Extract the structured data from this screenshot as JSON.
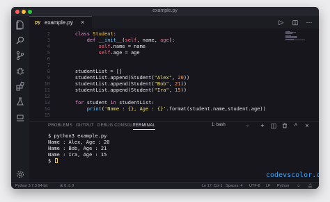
{
  "window": {
    "title": "example.py"
  },
  "tab": {
    "icon_text": "py",
    "label": "example.py",
    "close": "×"
  },
  "editor_actions": {
    "run": "▷",
    "split": "◫",
    "more": "···"
  },
  "code_lines": [
    {
      "n": "2",
      "tokens": [
        [
          "t",
          "    "
        ],
        [
          "kw",
          "class "
        ],
        [
          "cls",
          "Student"
        ],
        [
          "t",
          ":"
        ]
      ]
    },
    {
      "n": "3",
      "tokens": [
        [
          "t",
          "        "
        ],
        [
          "kw",
          "def "
        ],
        [
          "fn",
          "__init__"
        ],
        [
          "t",
          "("
        ],
        [
          "slf",
          "self"
        ],
        [
          "t",
          ", name, "
        ],
        [
          "slf",
          "age"
        ],
        [
          "t",
          "):"
        ]
      ]
    },
    {
      "n": "4",
      "tokens": [
        [
          "t",
          "            "
        ],
        [
          "slf",
          "self"
        ],
        [
          "t",
          ".name = name"
        ]
      ]
    },
    {
      "n": "5",
      "tokens": [
        [
          "t",
          "            "
        ],
        [
          "slf",
          "self"
        ],
        [
          "t",
          ".age = age"
        ]
      ]
    },
    {
      "n": "6",
      "tokens": []
    },
    {
      "n": "7",
      "tokens": []
    },
    {
      "n": "8",
      "tokens": [
        [
          "t",
          "    studentList = []"
        ]
      ]
    },
    {
      "n": "9",
      "tokens": [
        [
          "t",
          "    studentList.append(Student("
        ],
        [
          "str",
          "\"Alex\""
        ],
        [
          "t",
          ", "
        ],
        [
          "num",
          "20"
        ],
        [
          "t",
          "))"
        ]
      ]
    },
    {
      "n": "10",
      "tokens": [
        [
          "t",
          "    studentList.append(Student("
        ],
        [
          "str",
          "\"Bob\""
        ],
        [
          "t",
          ", "
        ],
        [
          "num",
          "21"
        ],
        [
          "t",
          "))"
        ]
      ]
    },
    {
      "n": "11",
      "tokens": [
        [
          "t",
          "    studentList.append(Student("
        ],
        [
          "str",
          "\"Ira\""
        ],
        [
          "t",
          ", "
        ],
        [
          "num",
          "15"
        ],
        [
          "t",
          "))"
        ]
      ]
    },
    {
      "n": "12",
      "tokens": []
    },
    {
      "n": "13",
      "tokens": [
        [
          "t",
          "    "
        ],
        [
          "kw",
          "for "
        ],
        [
          "t",
          "student "
        ],
        [
          "kw",
          "in "
        ],
        [
          "t",
          "studentList:"
        ]
      ]
    },
    {
      "n": "14",
      "tokens": [
        [
          "t",
          "        "
        ],
        [
          "fn",
          "print"
        ],
        [
          "t",
          "("
        ],
        [
          "str",
          "'Name : {}, Age : {}'"
        ],
        [
          "t",
          ".format(student.name,student.age))"
        ]
      ]
    },
    {
      "n": "15",
      "tokens": []
    }
  ],
  "panel": {
    "tabs": [
      "PROBLEMS",
      "OUTPUT",
      "DEBUG CONSOLE",
      "TERMINAL"
    ],
    "active_tab": "TERMINAL",
    "terminal_select": "1: bash",
    "actions": {
      "add": "+",
      "split": "◫",
      "trash": "🗑",
      "maximize": "^",
      "close": "×"
    },
    "terminal_lines": [
      "$ python3 example.py",
      "Name : Alex, Age : 20",
      "Name : Bob, Age : 21",
      "Name : Ira, Age : 15",
      "$ "
    ],
    "watermark": "codevscolor.com"
  },
  "status": {
    "python": "Python 3.7.3 64-bit",
    "errors": "⊗ 0  ⚠ 0",
    "position": "Ln 17, Col 1",
    "spaces": "Spaces: 4",
    "encoding": "UTF-8",
    "eol": "LF",
    "language": "Python"
  },
  "colors": {
    "accent": "#3a3aee",
    "background": "#16161c",
    "sidebar": "#1c1c23",
    "watermark": "#3fa8ff"
  }
}
